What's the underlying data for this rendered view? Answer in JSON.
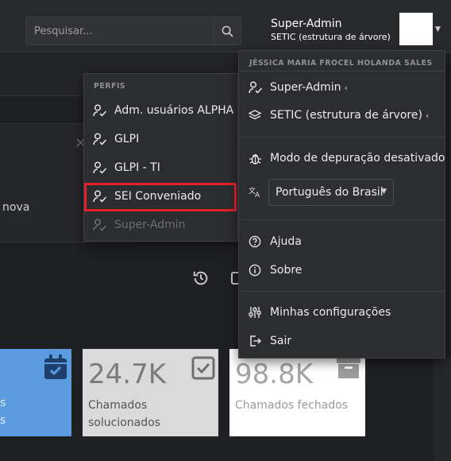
{
  "header": {
    "search_placeholder": "Pesquisar...",
    "user_name": "Super-Admin",
    "user_entity": "SETIC (estrutura de árvore)"
  },
  "background": {
    "partial_text": "nova",
    "tiles": [
      {
        "number": "",
        "label_lines": [
          "s",
          "s"
        ]
      },
      {
        "number": "24.7K",
        "label": "Chamados solucionados"
      },
      {
        "number": "98.8K",
        "label": "Chamados fechados"
      }
    ]
  },
  "profiles_menu": {
    "header": "PERFIS",
    "items": [
      {
        "label": "Adm. usuários ALPHA",
        "icon": "user-check-icon",
        "state": "normal"
      },
      {
        "label": "GLPI",
        "icon": "user-check-icon",
        "state": "normal"
      },
      {
        "label": "GLPI - TI",
        "icon": "user-check-icon",
        "state": "normal"
      },
      {
        "label": "SEI Conveniado",
        "icon": "user-check-icon",
        "state": "highlighted"
      },
      {
        "label": "Super-Admin",
        "icon": "user-check-icon",
        "state": "disabled"
      }
    ]
  },
  "user_menu": {
    "header": "JÉSSICA MARIA FROCEL HOLANDA SALES",
    "profile": "Super-Admin",
    "entity": "SETIC (estrutura de árvore)",
    "debug": "Modo de depuração desativado",
    "language": "Português do Brasil",
    "help": "Ajuda",
    "about": "Sobre",
    "settings": "Minhas configurações",
    "logout": "Sair"
  },
  "colors": {
    "highlight_border": "#e3202b",
    "tile_blue": "#5b9be0",
    "tile_grey": "#dadada"
  }
}
